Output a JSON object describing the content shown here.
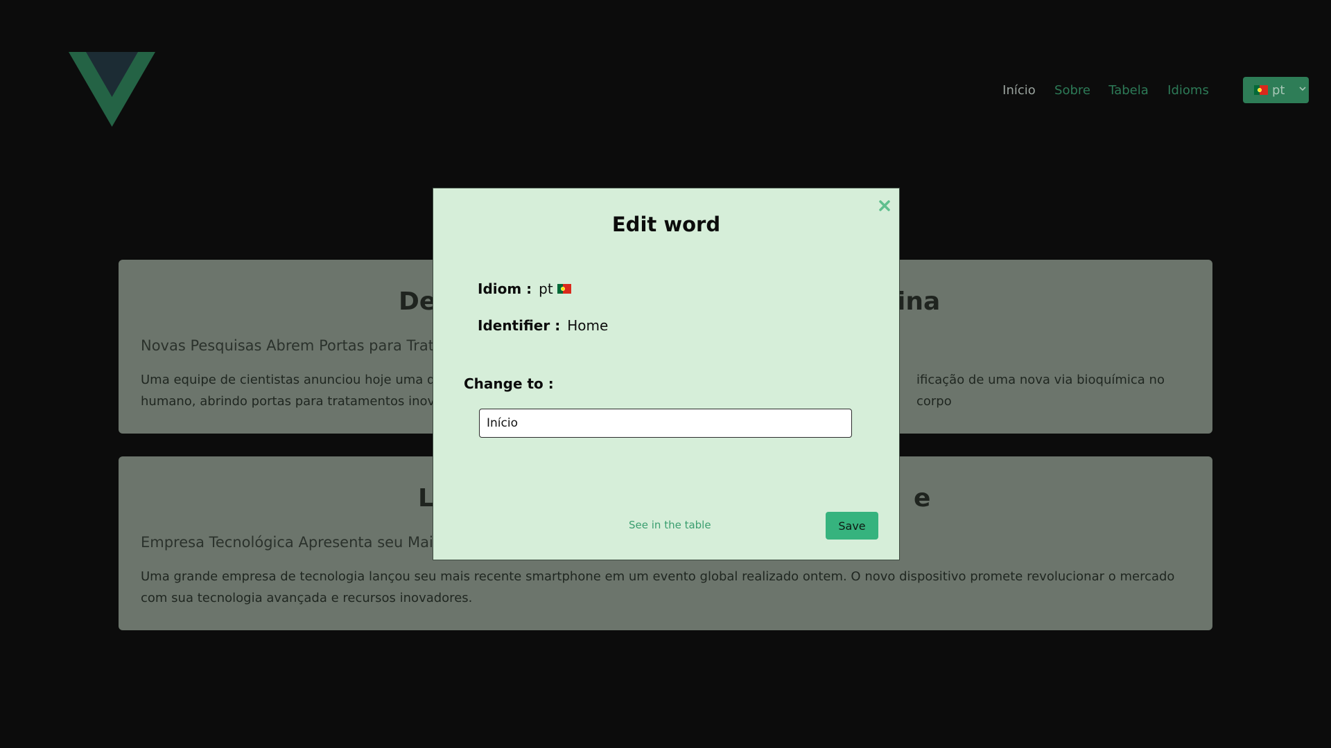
{
  "header": {
    "logo_icon": "vue-logo-icon",
    "nav": [
      {
        "label": "Início",
        "active": true
      },
      {
        "label": "Sobre",
        "active": false
      },
      {
        "label": "Tabela",
        "active": false
      },
      {
        "label": "Idioms",
        "active": false
      }
    ],
    "language": {
      "value": "pt",
      "flag_icon": "portugal-flag-icon"
    }
  },
  "cards": [
    {
      "title": "De",
      "title_end": "ina",
      "subtitle": "Novas Pesquisas Abrem Portas para Trata",
      "body_start": "Uma equipe de cientistas anunciou hoje uma des",
      "body_end": "ificação de uma nova via bioquímica no corpo",
      "body_line2": "humano, abrindo portas para tratamentos inovad"
    },
    {
      "title": "L",
      "title_end": "e",
      "subtitle": "Empresa Tecnológica Apresenta seu Mais",
      "body": "Uma grande empresa de tecnologia lançou seu mais recente smartphone em um evento global realizado ontem. O novo dispositivo promete revolucionar o mercado com sua tecnologia avançada e recursos inovadores."
    }
  ],
  "modal": {
    "title": "Edit word",
    "idiom_label": "Idiom :",
    "idiom_value": "pt",
    "identifier_label": "Identifier :",
    "identifier_value": "Home",
    "change_label": "Change to :",
    "change_value": "Início",
    "see_link": "See in the table",
    "save_label": "Save",
    "close_icon": "close-icon"
  },
  "colors": {
    "background": "#0c0c0c",
    "accent": "#36b37e",
    "modal_bg": "#d6eed9",
    "card_bg": "#6c756c"
  }
}
